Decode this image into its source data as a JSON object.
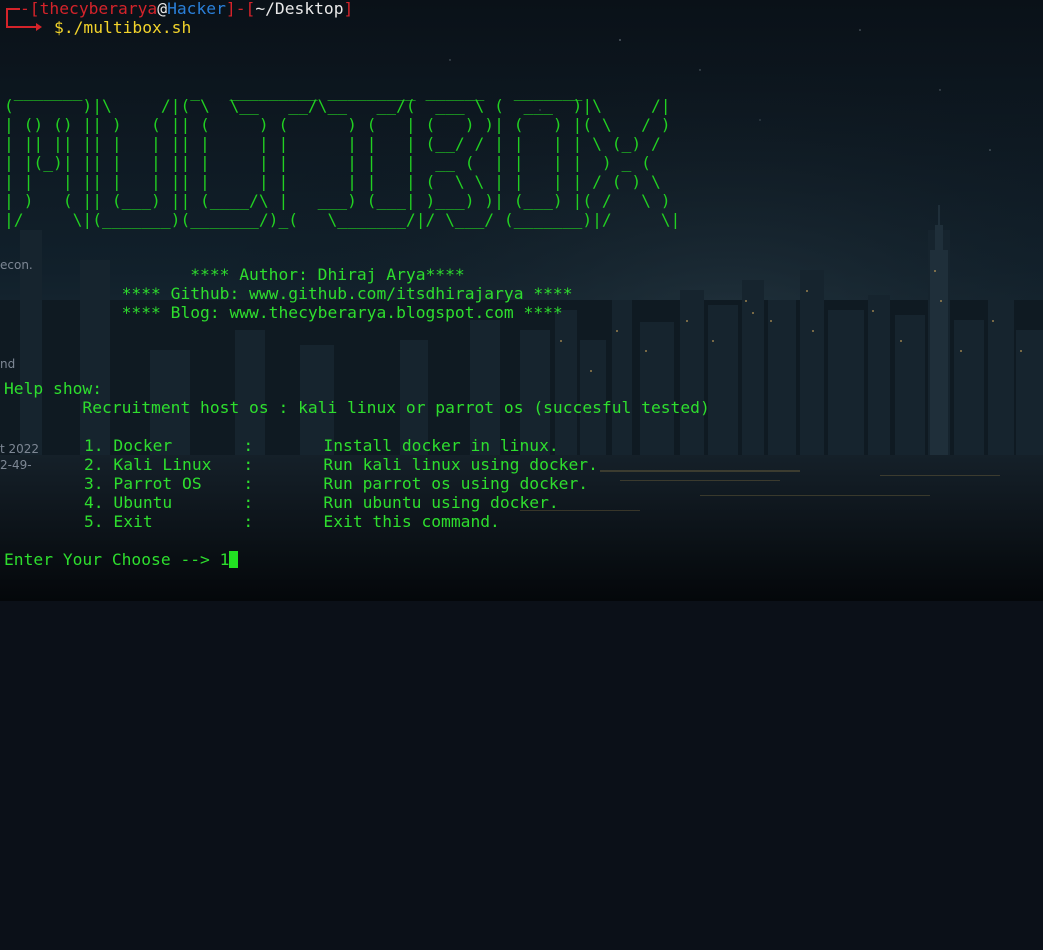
{
  "prompt": {
    "user": "thecyberarya",
    "at": "@",
    "host": "Hacker",
    "dir": "~/Desktop",
    "dollar": "$",
    "command": "./multibox.sh"
  },
  "banner": {
    "lines": [
      " _______           _   _________ _________ ______   _______          ",
      "(       )|\\     /|( \\  \\__   __/\\__   __/(  ___ \\ (  ___  )|\\     /|",
      "| () () || )   ( || (     ) (      ) (   | (   ) )| (   ) |( \\   / )",
      "| || || || |   | || |     | |      | |   | (__/ / | |   | | \\ (_) / ",
      "| |(_)| || |   | || |     | |      | |   |  __ (  | |   | |  ) _ (  ",
      "| |   | || |   | || |     | |      | |   | (  \\ \\ | |   | | / ( ) \\ ",
      "| )   ( || (___) || (____/\\ |   ___) (___| )___) )| (___) |( /   \\ )",
      "|/     \\|(_______)(_______/)_(   \\_______/|/ \\___/ (_______)|/     \\|"
    ]
  },
  "info": {
    "author": "                   **** Author: Dhiraj Arya****",
    "github": "            **** Github: www.github.com/itsdhirajarya ****",
    "blog": "            **** Blog: www.thecyberarya.blogspot.com ****"
  },
  "help": {
    "title": "Help show:",
    "recruitment": "        Recruitment host os : kali linux or parrot os (succesful tested)",
    "options": [
      {
        "num": "1.",
        "name": "Docker",
        "desc": "Install docker in linux."
      },
      {
        "num": "2.",
        "name": "Kali Linux",
        "desc": "Run kali linux using docker."
      },
      {
        "num": "3.",
        "name": "Parrot OS",
        "desc": "Run parrot os using docker."
      },
      {
        "num": "4.",
        "name": "Ubuntu",
        "desc": "Run ubuntu using docker."
      },
      {
        "num": "5.",
        "name": "Exit",
        "desc": "Exit this command."
      }
    ],
    "separator": ":"
  },
  "input": {
    "label": "Enter Your Choose --> ",
    "value": "1"
  },
  "desktop_labels": {
    "a": "econ.",
    "b": "nd",
    "c": "t 2022",
    "d": "2-49-"
  },
  "colors": {
    "text_green": "#2ede2e",
    "prompt_red": "#d4232a",
    "prompt_blue": "#2a7fd8",
    "command_yellow": "#f2d32b",
    "cursor_green": "#22e222"
  }
}
